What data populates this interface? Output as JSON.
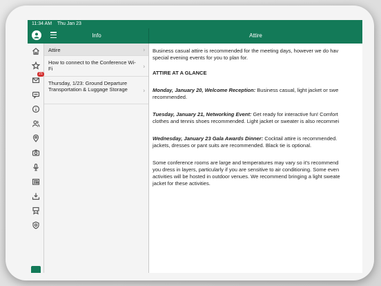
{
  "status": {
    "time": "11:34 AM",
    "date": "Thu Jan 23"
  },
  "navbar": {
    "left_title": "Info",
    "right_title": "Attire"
  },
  "rail": {
    "items": [
      {
        "icon": "home-icon"
      },
      {
        "icon": "star-icon"
      },
      {
        "icon": "mail-icon",
        "badge": "21"
      },
      {
        "icon": "chat-icon"
      },
      {
        "icon": "info-icon"
      },
      {
        "icon": "people-icon"
      },
      {
        "icon": "map-pin-icon"
      },
      {
        "icon": "camera-icon"
      },
      {
        "icon": "microphone-icon"
      },
      {
        "icon": "newspaper-icon"
      },
      {
        "icon": "download-icon"
      },
      {
        "icon": "award-icon"
      },
      {
        "icon": "badge-icon"
      }
    ]
  },
  "list": {
    "items": [
      {
        "label": "Attire"
      },
      {
        "label": "How to connect to the Conference Wi-Fi"
      },
      {
        "label": "Thursday, 1/23: Ground Departure Transportation & Luggage Storage"
      }
    ]
  },
  "content": {
    "intro_line1": "Business casual attire is recommended for the meeting days, however we do hav",
    "intro_line2": "special evening events for you to plan for.",
    "heading": "ATTIRE AT A GLANCE",
    "p1_title": "Monday, January 20, Welcome Reception:",
    "p1_line1": " Business casual, light jacket or swe",
    "p1_line2": "recommended.",
    "p2_title": "Tuesday, January 21, Networking Event:",
    "p2_line1": " Get ready for interactive fun! Comfort",
    "p2_line2": "clothes and tennis shoes recommended. Light jacket or sweater is also recommei",
    "p3_title": "Wednesday, January 23 Gala Awards Dinner:",
    "p3_line1": " Cocktail attire is recommended.",
    "p3_line2": "jackets, dresses or pant suits are recommended. Black tie is optional.",
    "p4_line1": "Some conference rooms are large and temperatures may vary so it's recommend",
    "p4_line2": "you dress in layers, particularly if you are sensitive to air conditioning. Some even",
    "p4_line3": "activities will be hosted in outdoor venues. We recommend bringing a light sweate",
    "p4_line4": "jacket for these activities."
  },
  "colors": {
    "brand": "#137a58",
    "badge": "#d32f2f"
  }
}
